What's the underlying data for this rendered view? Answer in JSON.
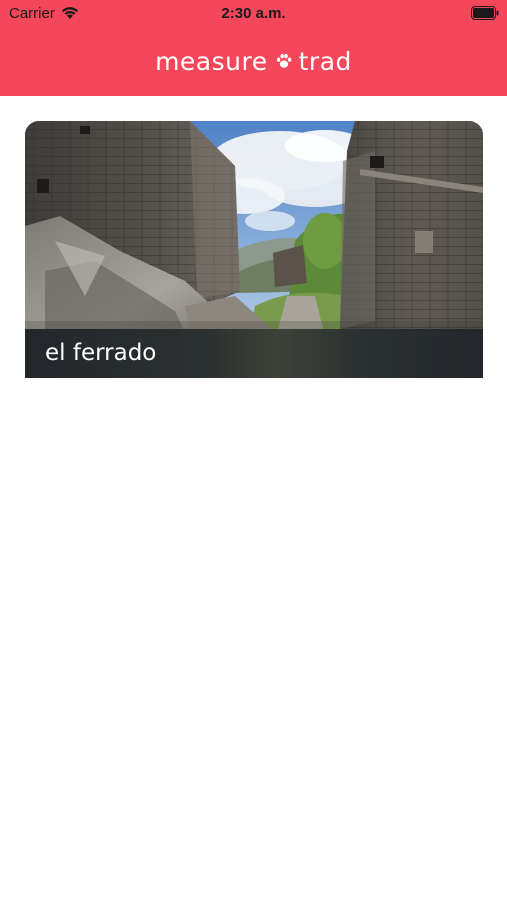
{
  "status_bar": {
    "carrier": "Carrier",
    "time": "2:30 a.m."
  },
  "app_bar": {
    "title_left": "measure",
    "title_right": "trad",
    "logo_icon": "paw-icon",
    "background": "#f4475b"
  },
  "places": [
    {
      "name": "el ferrado"
    }
  ]
}
